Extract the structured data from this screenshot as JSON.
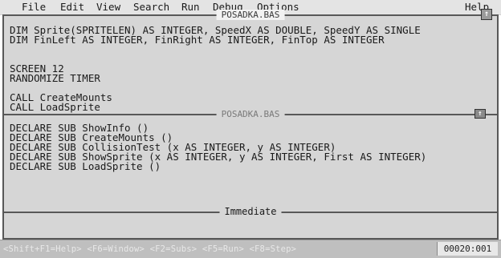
{
  "menubar": {
    "items": [
      "File",
      "Edit",
      "View",
      "Search",
      "Run",
      "Debug",
      "Options"
    ],
    "help": "Help"
  },
  "windows": {
    "editor": {
      "title": "POSADKA.BAS",
      "lines": [
        "DIM Sprite(SPRITELEN) AS INTEGER, SpeedX AS DOUBLE, SpeedY AS SINGLE",
        "DIM FinLeft AS INTEGER, FinRight AS INTEGER, FinTop AS INTEGER",
        "",
        "",
        "SCREEN 12",
        "RANDOMIZE TIMER",
        "",
        "CALL CreateMounts",
        "CALL LoadSprite"
      ]
    },
    "split": {
      "title": "POSADKA.BAS",
      "lines": [
        "DECLARE SUB ShowInfo ()",
        "DECLARE SUB CreateMounts ()",
        "DECLARE SUB CollisionTest (x AS INTEGER, y AS INTEGER)",
        "DECLARE SUB ShowSprite (x AS INTEGER, y AS INTEGER, First AS INTEGER)",
        "DECLARE SUB LoadSprite ()"
      ]
    },
    "immediate": {
      "title": "Immediate"
    }
  },
  "statusbar": {
    "help_text": "<Shift+F1=Help> <F6=Window> <F2=Subs> <F5=Run> <F8=Step>",
    "position": "00020:001"
  }
}
